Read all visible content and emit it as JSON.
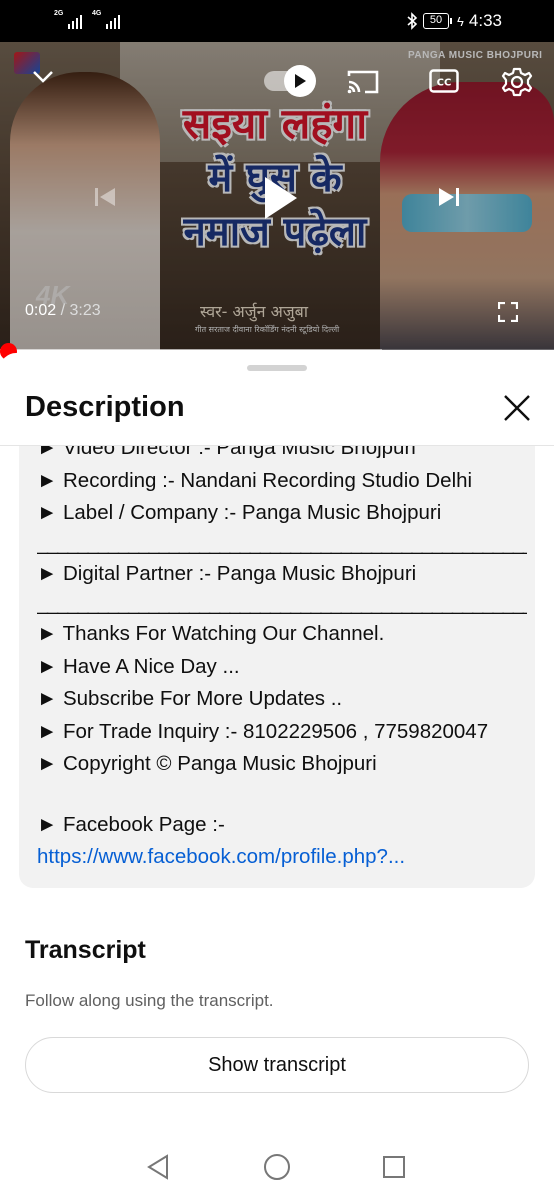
{
  "status_bar": {
    "sim1_tag": "2G",
    "sim2_tag": "4G",
    "battery": "50",
    "time": "4:33"
  },
  "player": {
    "current_time": "0:02",
    "separator": "/",
    "duration": "3:23",
    "progress_fraction": 0.01,
    "buffered_fraction": 0.69,
    "thumbnail": {
      "title_line1": "सइया लहंगा",
      "title_line2": "में घुस के",
      "title_line3": "नमाज पढ़ेला",
      "singer": "स्वर- अर्जुन अजुबा",
      "brand": "PANGA MUSIC BHOJPURI",
      "badge": "4K",
      "credits": "गीत सरताज दीवाना रिकॉर्डिंग नंदनी स्टूडियो दिल्ली"
    },
    "icons": [
      "chevron-down-icon",
      "autoplay-toggle-icon",
      "cast-icon",
      "closed-captions-icon",
      "settings-gear-icon",
      "previous-icon",
      "play-icon",
      "next-icon",
      "fullscreen-icon"
    ]
  },
  "sheet": {
    "title": "Description",
    "lines": [
      "► Video Director :- Panga Music Bhojpuri",
      "► Recording :- Nandani Recording Studio Delhi",
      "► Label / Company :- Panga Music Bhojpuri",
      "____________________________________________________",
      "► Digital Partner :- Panga Music Bhojpuri",
      "____________________________________________________",
      "► Thanks For Watching Our  Channel.",
      "► Have A Nice Day ...",
      "► Subscribe For More Updates ..",
      "► For Trade Inquiry :- 8102229506 , 7759820047",
      "► Copyright © Panga Music Bhojpuri",
      "► Facebook Page :-"
    ],
    "facebook_link": "https://www.facebook.com/profile.php?...",
    "transcript": {
      "title": "Transcript",
      "subtitle": "Follow along using the transcript.",
      "button": "Show transcript"
    }
  },
  "colors": {
    "accent_red": "#ff0000",
    "link_blue": "#065fd4",
    "card_bg": "#f2f2f2"
  }
}
